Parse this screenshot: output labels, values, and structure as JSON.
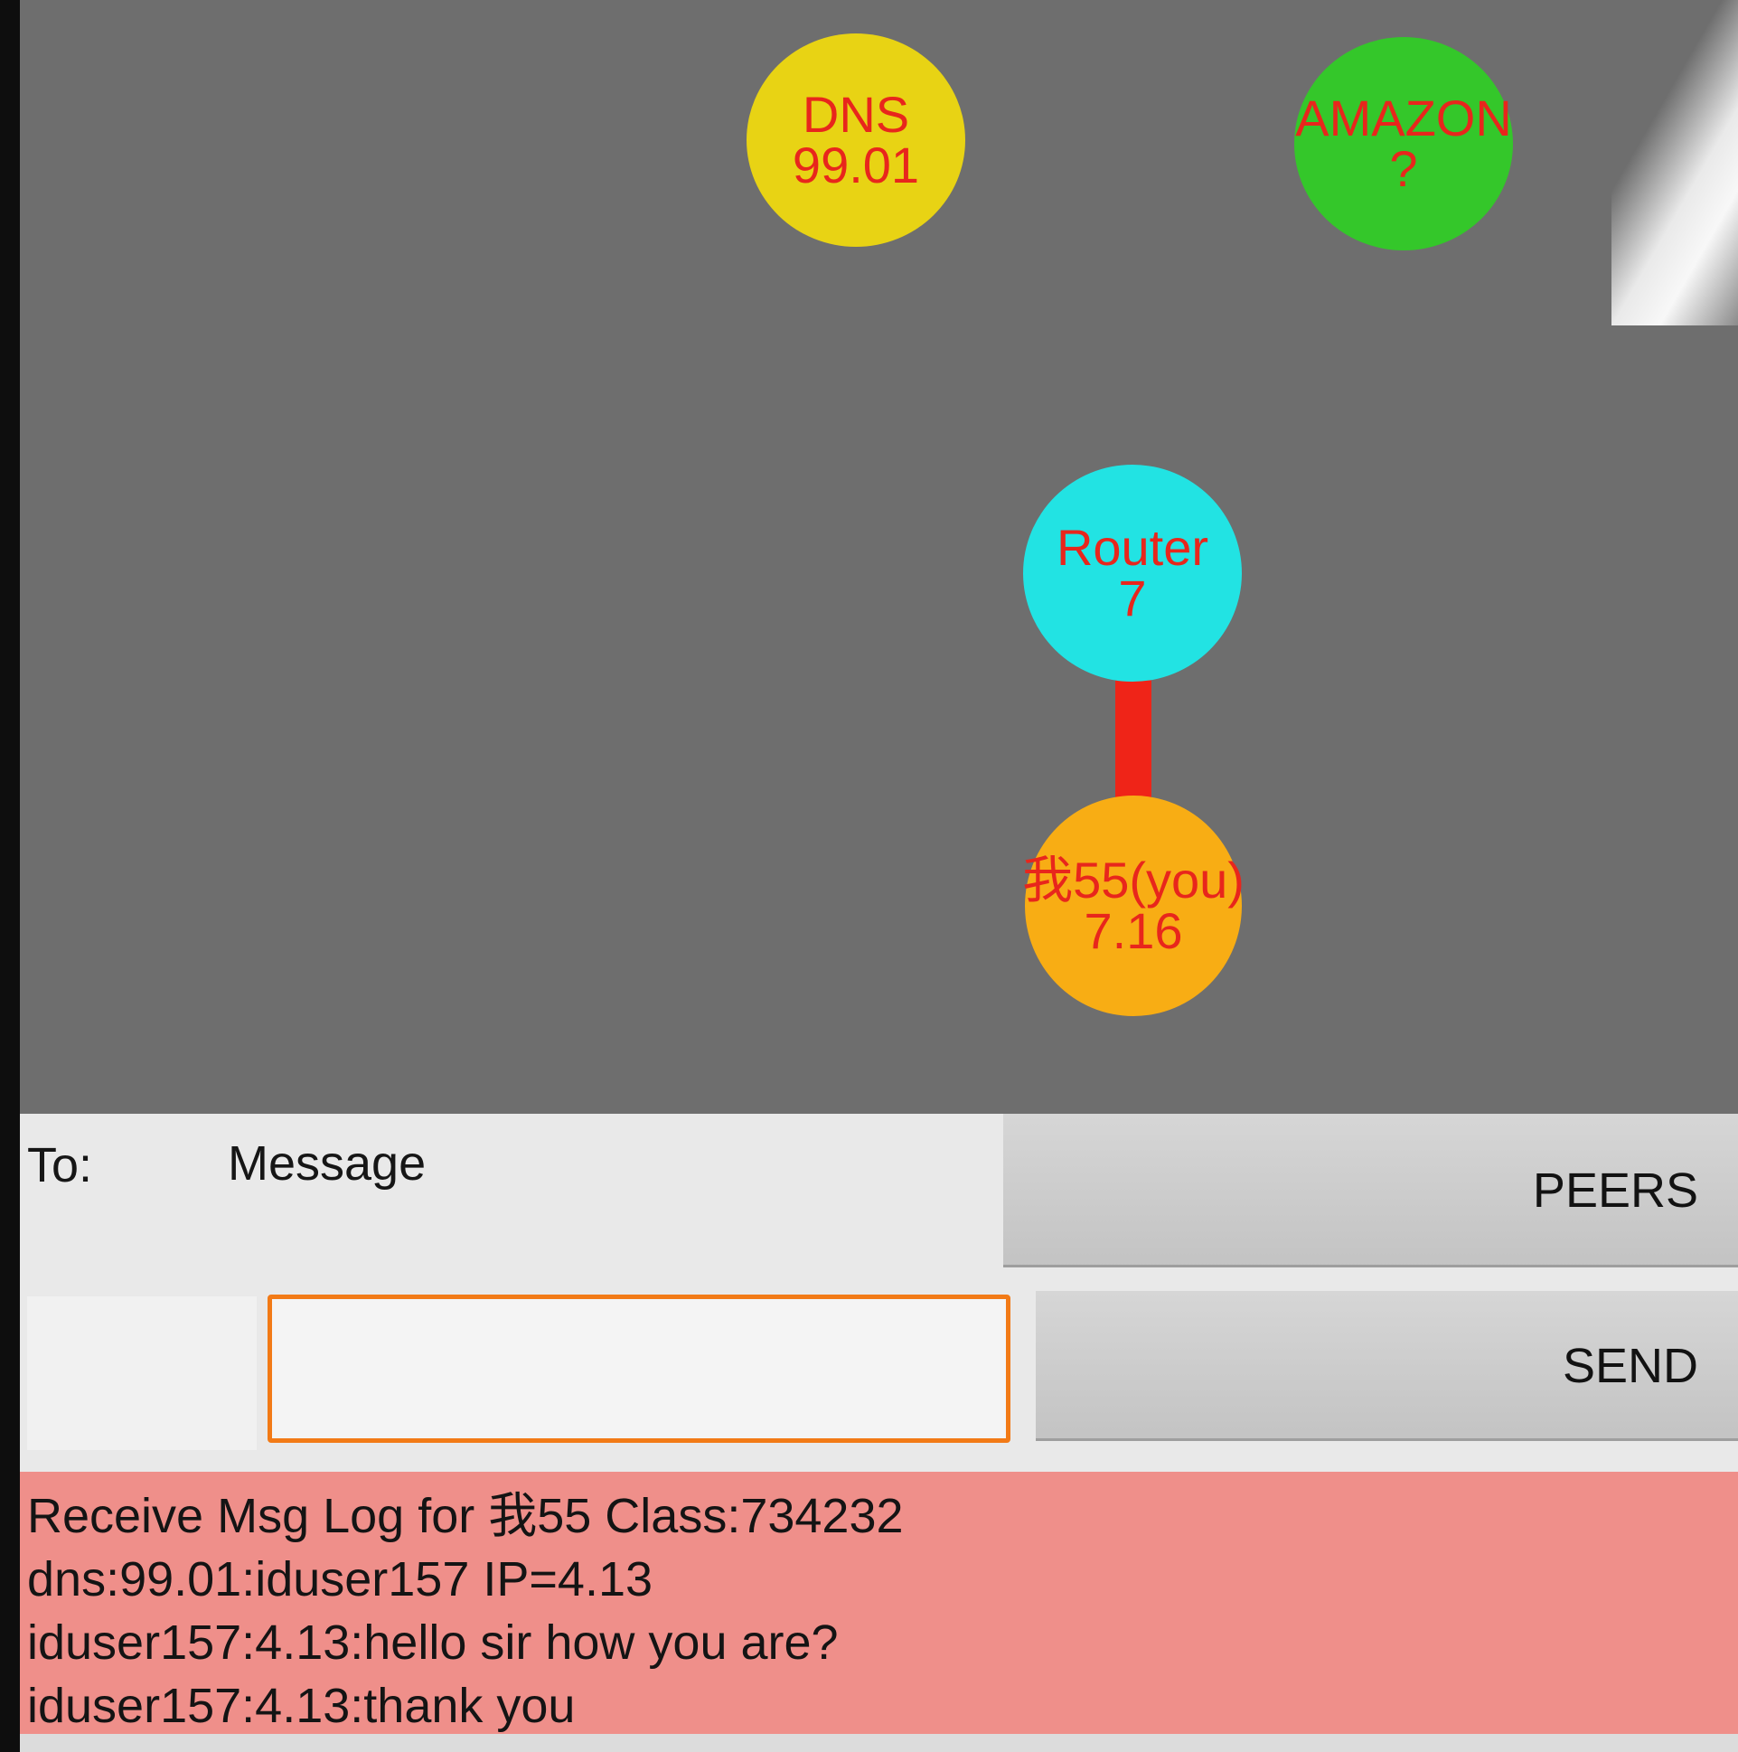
{
  "network": {
    "nodes": {
      "dns": {
        "label": "DNS",
        "value": "99.01",
        "color": "#e8d314"
      },
      "amazon": {
        "label": "AMAZON",
        "value": "?",
        "color": "#34c72a"
      },
      "router": {
        "label": "Router",
        "value": "7",
        "color": "#22e3e3"
      },
      "you": {
        "label": "我55(you)",
        "value": "7.16",
        "color": "#f8ad14"
      }
    },
    "link_color": "#ef2418",
    "node_text_color": "#e8261c",
    "background": "#6e6e6e"
  },
  "compose": {
    "to_label": "To:",
    "message_label": "Message",
    "to_value": "",
    "message_value": "",
    "message_border_color": "#f27a16"
  },
  "buttons": {
    "peers_label": "PEERS",
    "send_label": "SEND"
  },
  "log": {
    "background": "#ef8f8a",
    "lines": [
      "Receive Msg Log for 我55 Class:734232",
      "dns:99.01:iduser157  IP=4.13",
      "iduser157:4.13:hello sir how you are?",
      "iduser157:4.13:thank you"
    ]
  }
}
